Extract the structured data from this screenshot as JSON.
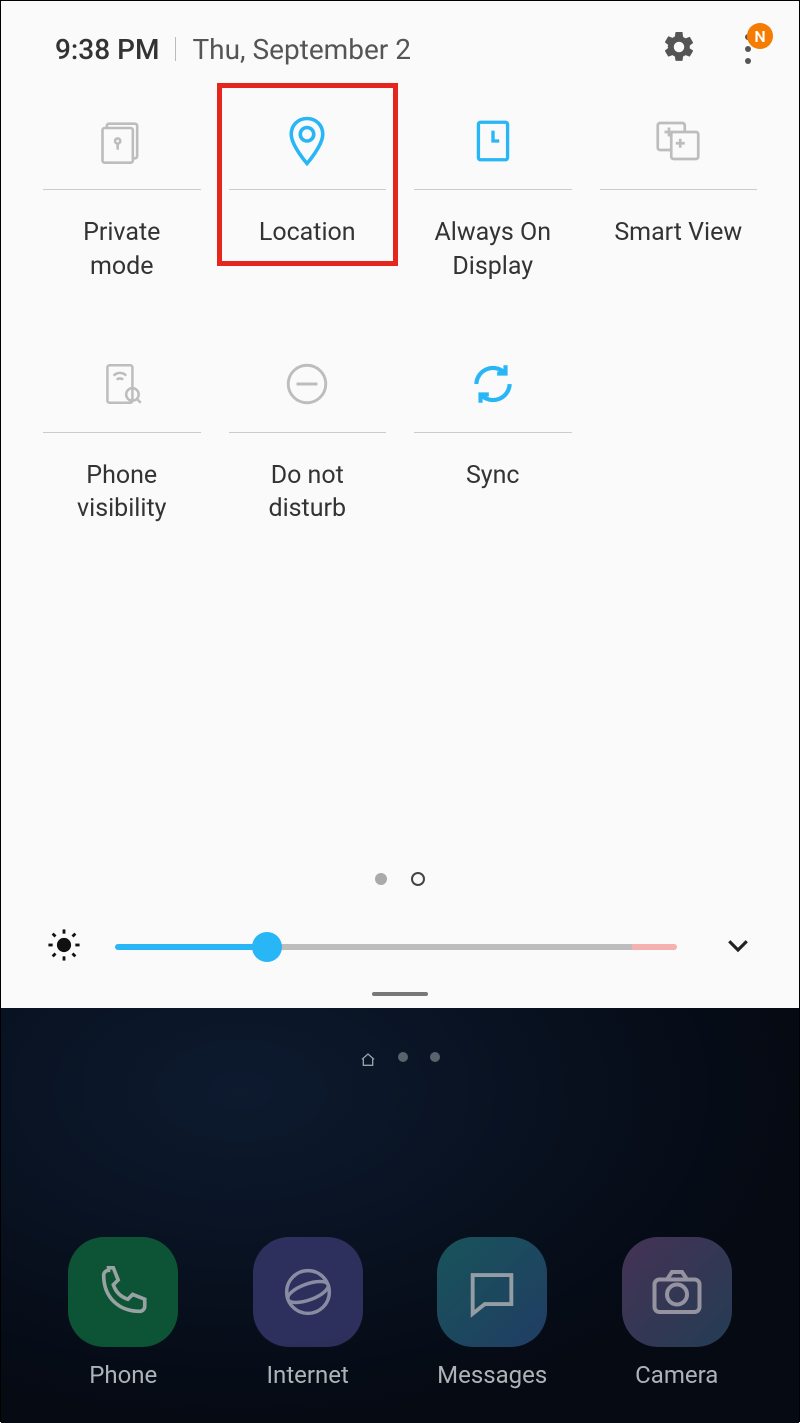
{
  "status": {
    "time": "9:38 PM",
    "date": "Thu, September 2",
    "badge_letter": "N"
  },
  "tiles": [
    {
      "id": "private-mode",
      "label": "Private\nmode",
      "active": false,
      "highlighted": false
    },
    {
      "id": "location",
      "label": "Location",
      "active": true,
      "highlighted": true
    },
    {
      "id": "always-on-display",
      "label": "Always On\nDisplay",
      "active": true,
      "highlighted": false
    },
    {
      "id": "smart-view",
      "label": "Smart View",
      "active": false,
      "highlighted": false
    },
    {
      "id": "phone-visibility",
      "label": "Phone\nvisibility",
      "active": false,
      "highlighted": false
    },
    {
      "id": "do-not-disturb",
      "label": "Do not\ndisturb",
      "active": false,
      "highlighted": false
    },
    {
      "id": "sync",
      "label": "Sync",
      "active": true,
      "highlighted": false
    }
  ],
  "brightness": {
    "percent": 27
  },
  "colors": {
    "active": "#29b6f6",
    "inactive": "#9e9e9e",
    "highlight": "#e5261f",
    "badge": "#f57c00"
  },
  "dock": [
    {
      "id": "phone",
      "label": "Phone"
    },
    {
      "id": "internet",
      "label": "Internet"
    },
    {
      "id": "messages",
      "label": "Messages"
    },
    {
      "id": "camera",
      "label": "Camera"
    }
  ]
}
